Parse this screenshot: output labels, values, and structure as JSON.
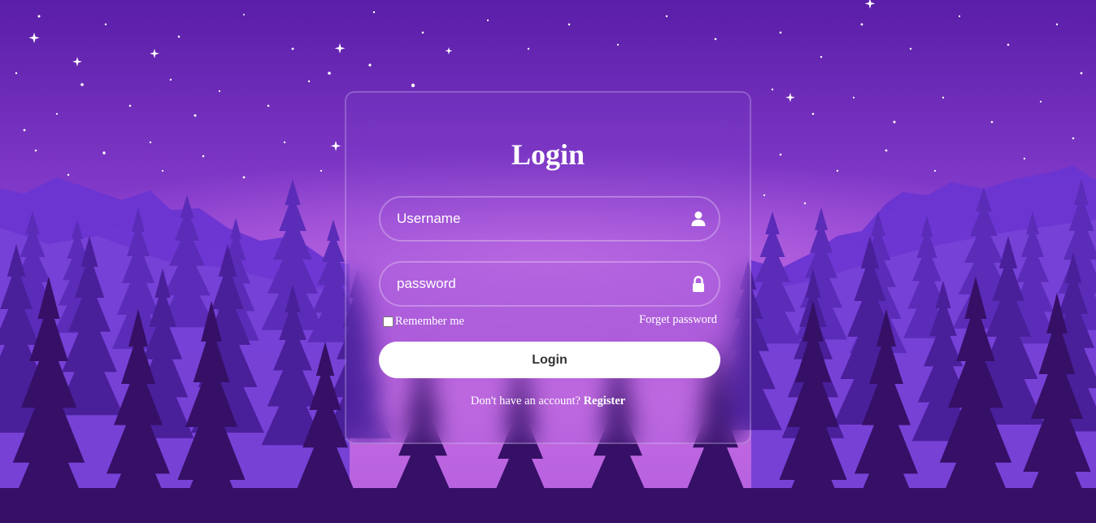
{
  "background": {
    "sky_colors": [
      "#5a1ea8",
      "#8a3fd0",
      "#c46be0"
    ],
    "mountain_color": "#6a35d2",
    "forest_colors": [
      "#5a2cb8",
      "#4a1f9a",
      "#351066"
    ]
  },
  "login": {
    "title": "Login",
    "username_placeholder": "Username",
    "username_icon": "user-icon",
    "password_placeholder": "password",
    "password_icon": "lock-icon",
    "remember_label": "Remember me",
    "remember_checked": false,
    "forgot_label": "Forget password",
    "button_label": "Login",
    "register_prompt": "Don't have an account?",
    "register_link": "Register"
  }
}
